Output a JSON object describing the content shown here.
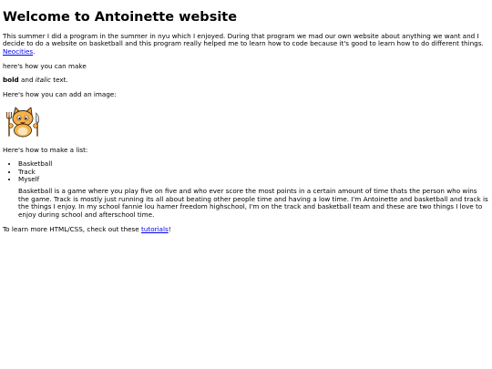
{
  "heading": "Welcome to Antoinette website",
  "intro": {
    "text": "This summer I did a program in the summer in nyu which I enjoyed. During that program we mad our own website about anything we want and I decide to do a website on basketball and this program really helped me to learn how to code because it's good to learn how to do different things. ",
    "link_text": "Neocities",
    "after_link": "."
  },
  "make_text": "here's how you can make",
  "format_line": {
    "bold": "bold",
    "middle": " and ",
    "italic": "italic",
    "end": " text."
  },
  "image_intro": "Here's how you can add an image:",
  "image_icon": "neocities-cat-mascot-icon",
  "list_intro": "Here's how to make a list:",
  "list_items": [
    "Basketball",
    "Track",
    "Myself"
  ],
  "paragraph": "Basketball is a game where you play five on five and who ever score the most points in a certain amount of time thats the person who wins the game. Track is mostly just running its all about beating other people time and having a low time. I'm Antoinette and basketball and track is the things I enjoy. In my school fannie lou hamer freedom highschool, I'm on the track and basketball team and these are two things I love to enjoy during school and afterschool time.",
  "footer": {
    "text": "To learn more HTML/CSS, check out these ",
    "link_text": "tutorials",
    "after_link": "!"
  }
}
